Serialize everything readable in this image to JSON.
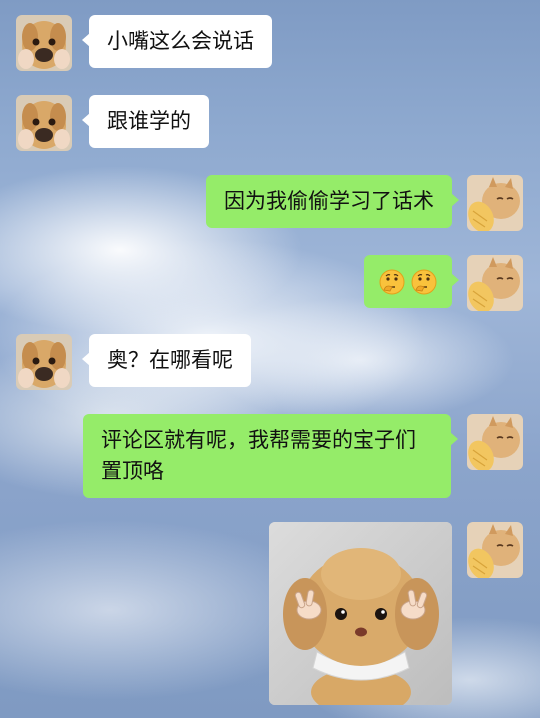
{
  "chat": {
    "messages": [
      {
        "side": "left",
        "text": "小嘴这么会说话"
      },
      {
        "side": "left",
        "text": "跟谁学的"
      },
      {
        "side": "right",
        "text": "因为我偷偷学习了话术"
      },
      {
        "side": "right",
        "emoji": [
          "thinking-face-emoji",
          "thinking-face-emoji"
        ]
      },
      {
        "side": "left",
        "text": "奥？在哪看呢"
      },
      {
        "side": "right",
        "text": "评论区就有呢，我帮需要的宝子们置顶咯"
      },
      {
        "side": "right",
        "sticker": "plush-puppy-sticker"
      }
    ]
  },
  "colors": {
    "outgoing_bubble": "#95ec69",
    "incoming_bubble": "#ffffff"
  }
}
